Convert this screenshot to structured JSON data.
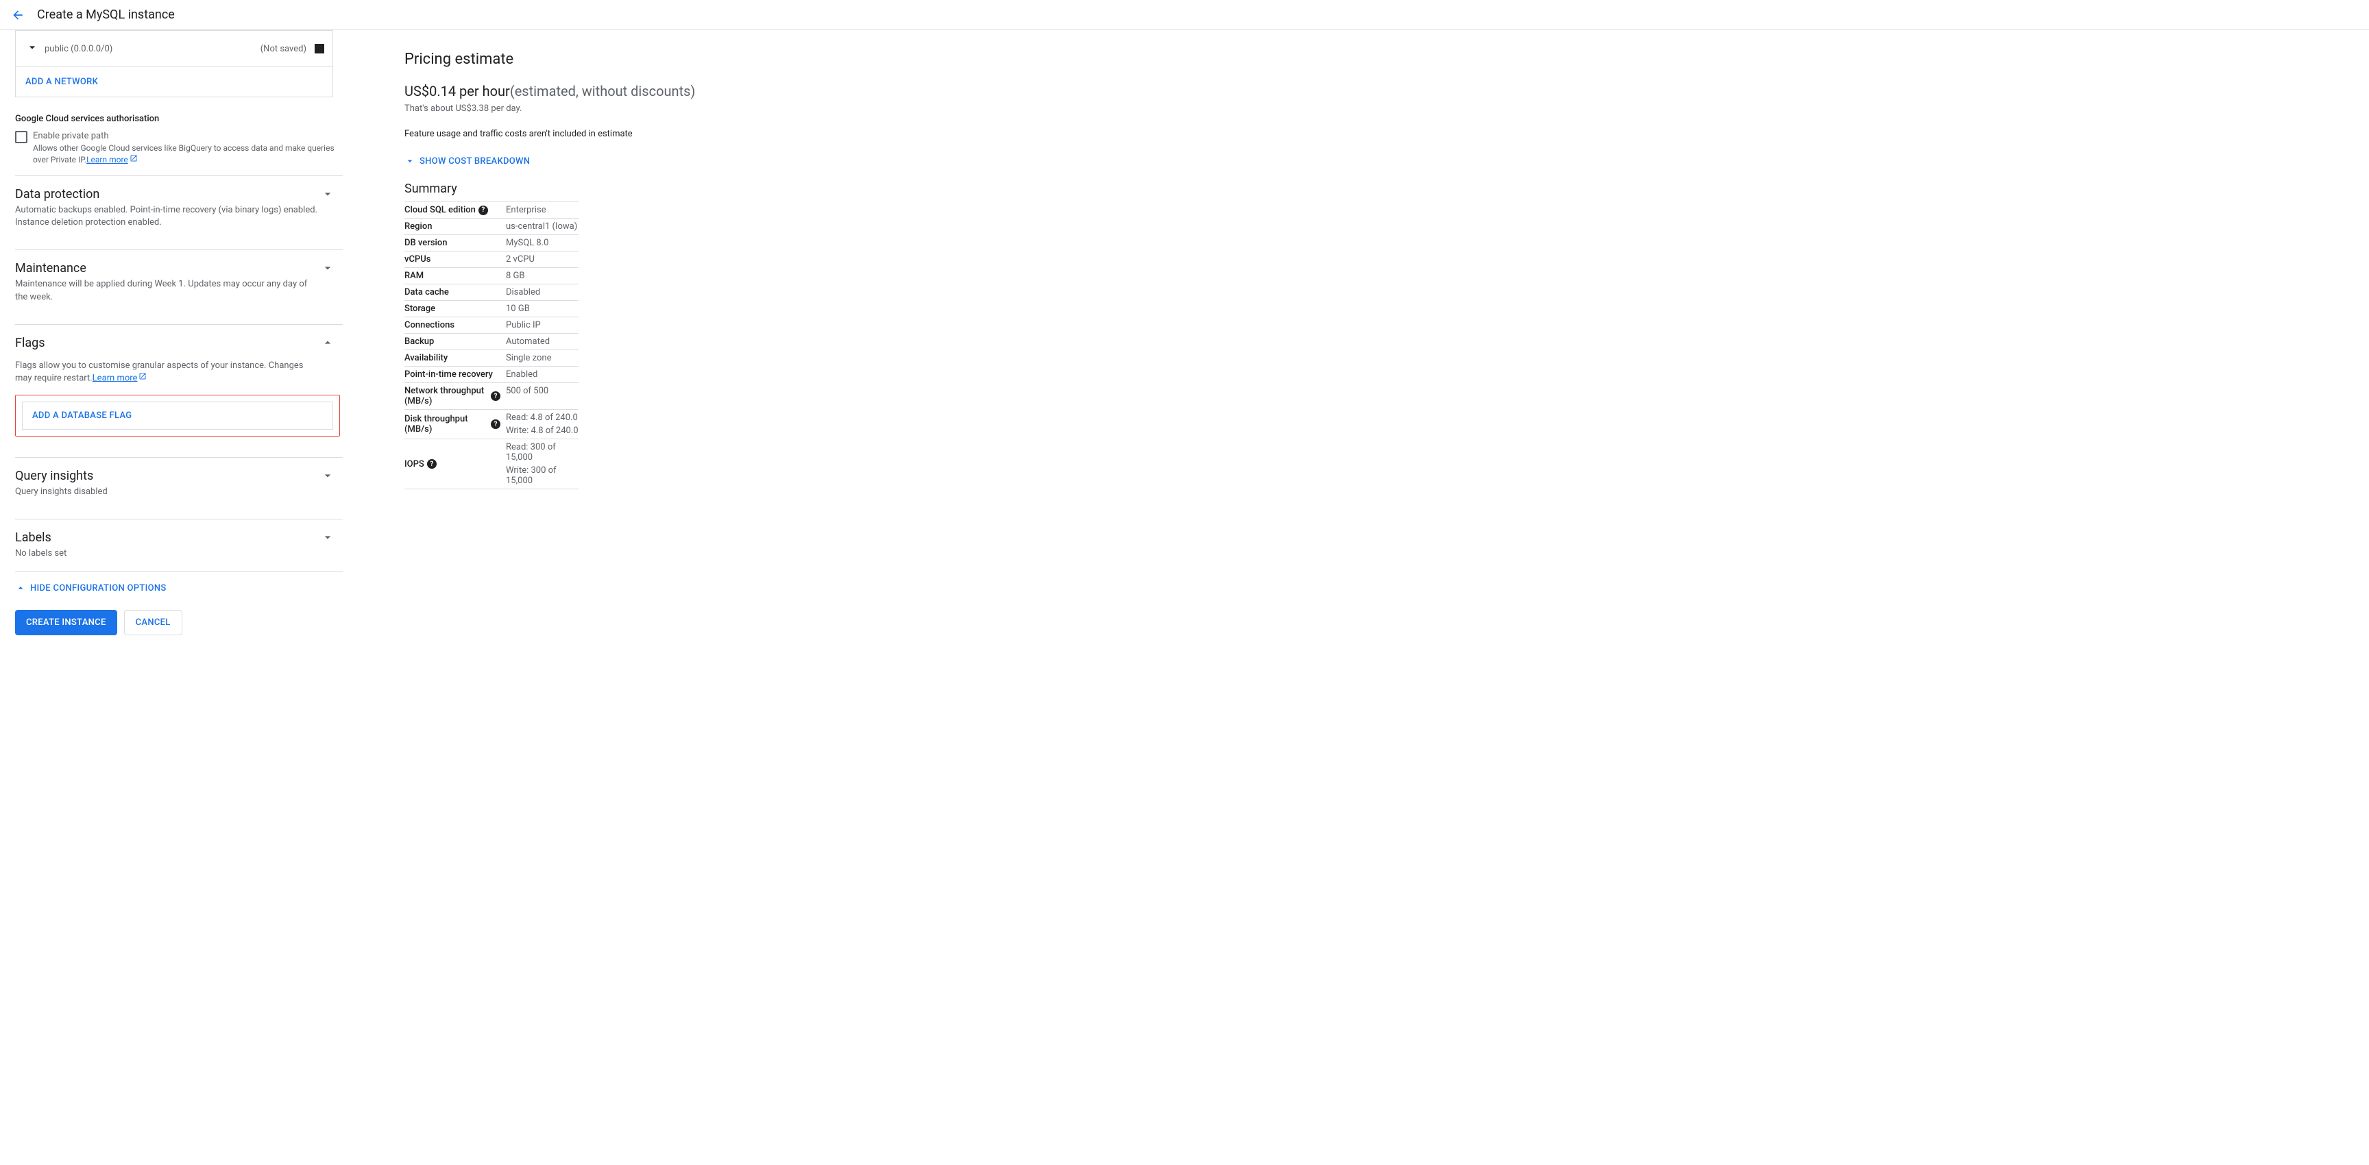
{
  "header": {
    "title": "Create a MySQL instance"
  },
  "network": {
    "label": "public (0.0.0.0/0)",
    "status": "(Not saved)",
    "add_button": "ADD A NETWORK"
  },
  "gcs": {
    "title": "Google Cloud services authorisation",
    "checkbox_label": "Enable private path",
    "checkbox_desc": "Allows other Google Cloud services like BigQuery to access data and make queries over Private IP.",
    "learn_more": "Learn more"
  },
  "sections": {
    "data_protection": {
      "title": "Data protection",
      "subtitle": "Automatic backups enabled. Point-in-time recovery (via binary logs) enabled. Instance deletion protection enabled."
    },
    "maintenance": {
      "title": "Maintenance",
      "subtitle": "Maintenance will be applied during Week 1. Updates may occur any day of the week."
    },
    "flags": {
      "title": "Flags",
      "desc": "Flags allow you to customise granular aspects of your instance. Changes may require restart.",
      "learn_more": "Learn more",
      "add_button": "ADD A DATABASE FLAG"
    },
    "query_insights": {
      "title": "Query insights",
      "subtitle": "Query insights disabled"
    },
    "labels": {
      "title": "Labels",
      "subtitle": "No labels set"
    }
  },
  "hide_config": "HIDE CONFIGURATION OPTIONS",
  "buttons": {
    "create": "CREATE INSTANCE",
    "cancel": "CANCEL"
  },
  "pricing": {
    "title": "Pricing estimate",
    "price": "US$0.14 per hour",
    "estimated": "(estimated, without discounts)",
    "per_day": "That's about US$3.38 per day.",
    "feature_usage": "Feature usage and traffic costs aren't included in estimate",
    "show_breakdown": "SHOW COST BREAKDOWN"
  },
  "summary": {
    "title": "Summary",
    "rows": [
      {
        "key": "Cloud SQL edition",
        "val": "Enterprise",
        "help": true
      },
      {
        "key": "Region",
        "val": "us-central1 (Iowa)"
      },
      {
        "key": "DB version",
        "val": "MySQL 8.0"
      },
      {
        "key": "vCPUs",
        "val": "2 vCPU"
      },
      {
        "key": "RAM",
        "val": "8 GB"
      },
      {
        "key": "Data cache",
        "val": "Disabled"
      },
      {
        "key": "Storage",
        "val": "10 GB"
      },
      {
        "key": "Connections",
        "val": "Public IP"
      },
      {
        "key": "Backup",
        "val": "Automated"
      },
      {
        "key": "Availability",
        "val": "Single zone"
      },
      {
        "key": "Point-in-time recovery",
        "val": "Enabled"
      },
      {
        "key": "Network throughput (MB/s)",
        "val": "500 of 500",
        "help": true
      },
      {
        "key": "Disk throughput (MB/s)",
        "val": "Read: 4.8 of 240.0",
        "val2": "Write: 4.8 of 240.0",
        "help": true
      },
      {
        "key": "IOPS",
        "val": "Read: 300 of 15,000",
        "val2": "Write: 300 of 15,000",
        "help": true
      }
    ]
  }
}
